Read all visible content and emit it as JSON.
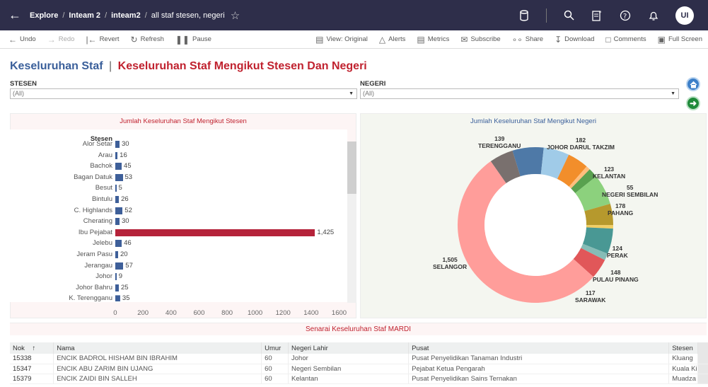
{
  "topbar": {
    "crumbs": [
      "Explore",
      "Inteam 2",
      "inteam2",
      "all staf stesen, negeri"
    ],
    "crumb_sep": "/",
    "user_initials": "UI"
  },
  "toolbar": {
    "undo": "Undo",
    "redo": "Redo",
    "revert": "Revert",
    "refresh": "Refresh",
    "pause": "Pause",
    "view": "View: Original",
    "alerts": "Alerts",
    "metrics": "Metrics",
    "subscribe": "Subscribe",
    "share": "Share",
    "download": "Download",
    "comments": "Comments",
    "fullscreen": "Full Screen"
  },
  "title": {
    "part1": "Keseluruhan Staf",
    "separator": "|",
    "part2": "Keseluruhan Staf Mengikut Stesen Dan Negeri"
  },
  "filters": {
    "stesen_label": "STESEN",
    "stesen_value": "(All)",
    "negeri_label": "NEGERI",
    "negeri_value": "(All)"
  },
  "colors": {
    "bar_default": "#3e5f99",
    "bar_highlight": "#b5233a",
    "title_blue": "#3a5f9a",
    "title_red": "#c0222f"
  },
  "chart_data": [
    {
      "type": "bar",
      "title": "Jumlah Keseluruhan Staf Mengikut Stesen",
      "category_header": "Stesen",
      "categories": [
        "Alor Setar",
        "Arau",
        "Bachok",
        "Bagan Datuk",
        "Besut",
        "Bintulu",
        "C. Highlands",
        "Cherating",
        "Ibu Pejabat",
        "Jelebu",
        "Jeram Pasu",
        "Jerangau",
        "Johor",
        "Johor Bahru",
        "K. Terengganu"
      ],
      "values": [
        30,
        16,
        45,
        53,
        5,
        26,
        52,
        30,
        1425,
        46,
        20,
        57,
        9,
        25,
        35
      ],
      "value_labels": [
        "30",
        "16",
        "45",
        "53",
        "5",
        "26",
        "52",
        "30",
        "1,425",
        "46",
        "20",
        "57",
        "9",
        "25",
        "35"
      ],
      "highlight": "Ibu Pejabat",
      "xticks": [
        0,
        200,
        400,
        600,
        800,
        1000,
        1200,
        1400,
        1600
      ],
      "xlim": [
        0,
        1600
      ],
      "orientation": "horizontal"
    },
    {
      "type": "pie",
      "subtype": "donut",
      "title": "Jumlah Keseluruhan Staf Mengikut Negeri",
      "slices": [
        {
          "name": "JOHOR DARUL TAKZIM",
          "value": 182,
          "color": "#4e79a7",
          "label": true
        },
        {
          "name": "",
          "value": 150,
          "color": "#a0cbe8",
          "label": false
        },
        {
          "name": "KELANTAN",
          "value": 123,
          "color": "#f28e2b",
          "label": true
        },
        {
          "name": "",
          "value": 24,
          "color": "#ffbe7d",
          "label": false
        },
        {
          "name": "NEGERI SEMBILAN",
          "value": 55,
          "color": "#59a14f",
          "label": true
        },
        {
          "name": "PAHANG",
          "value": 178,
          "color": "#8cd17d",
          "label": true
        },
        {
          "name": "PERAK",
          "value": 124,
          "color": "#b6992d",
          "label": true
        },
        {
          "name": "",
          "value": 20,
          "color": "#f1ce63",
          "label": false
        },
        {
          "name": "PULAU PINANG",
          "value": 148,
          "color": "#499894",
          "label": true
        },
        {
          "name": "",
          "value": 40,
          "color": "#86bcb6",
          "label": false
        },
        {
          "name": "SARAWAK",
          "value": 117,
          "color": "#e15759",
          "label": true
        },
        {
          "name": "SELANGOR",
          "value": 1505,
          "color": "#ff9d9a",
          "label": true
        },
        {
          "name": "TERENGGANU",
          "value": 139,
          "color": "#79706e",
          "label": true
        }
      ],
      "label_text": {
        "johor": [
          "182",
          "JOHOR DARUL TAKZIM"
        ],
        "kelantan": [
          "123",
          "KELANTAN"
        ],
        "nsembilan": [
          "55",
          "NEGERI SEMBILAN"
        ],
        "pahang": [
          "178",
          "PAHANG"
        ],
        "perak": [
          "124",
          "PERAK"
        ],
        "ppinang": [
          "148",
          "PULAU PINANG"
        ],
        "sarawak": [
          "117",
          "SARAWAK"
        ],
        "selangor": [
          "1,505",
          "SELANGOR"
        ],
        "terengganu": [
          "139",
          "TERENGGANU"
        ]
      }
    },
    {
      "type": "table",
      "title": "Senarai Keseluruhan Staf MARDI",
      "columns": [
        "Nok",
        "Nama",
        "Umur",
        "Negeri Lahir",
        "Pusat",
        "Stesen"
      ],
      "sort_indicator": "↑",
      "rows": [
        [
          "15338",
          "ENCIK BADROL HISHAM BIN IBRAHIM",
          "60",
          "Johor",
          "Pusat Penyelidikan Tanaman Industri",
          "Kluang"
        ],
        [
          "15347",
          "ENCIK ABU ZARIM BIN UJANG",
          "60",
          "Negeri Sembilan",
          "Pejabat Ketua Pengarah",
          "Kuala Ki"
        ],
        [
          "15379",
          "ENCIK ZAIDI BIN SALLEH",
          "60",
          "Kelantan",
          "Pusat Penyelidikan Sains Ternakan",
          "Muadza"
        ]
      ]
    }
  ]
}
